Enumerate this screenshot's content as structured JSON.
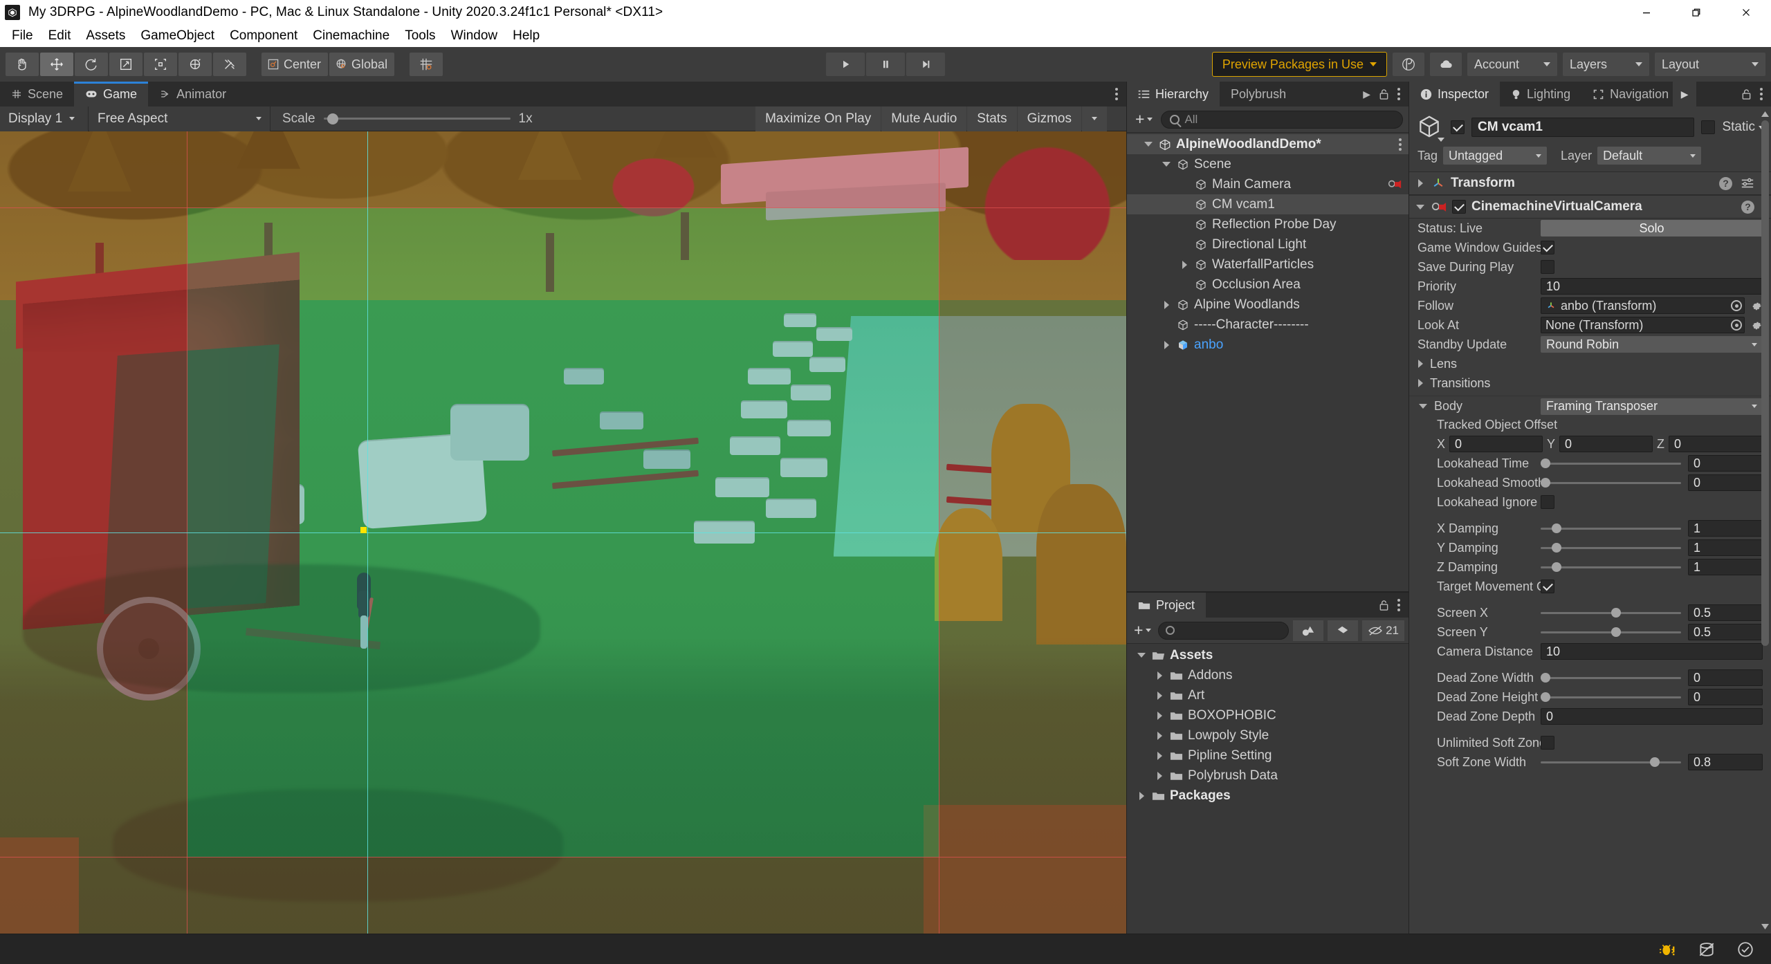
{
  "window": {
    "title": "My 3DRPG - AlpineWoodlandDemo - PC, Mac & Linux Standalone - Unity 2020.3.24f1c1 Personal* <DX11>",
    "app_icon": "unity-icon",
    "minimize": "minimize-icon",
    "maximize": "maximize-icon",
    "close": "close-icon"
  },
  "menubar": {
    "items": [
      "File",
      "Edit",
      "Assets",
      "GameObject",
      "Component",
      "Cinemachine",
      "Tools",
      "Window",
      "Help"
    ]
  },
  "toolbar": {
    "tools": [
      {
        "name": "hand-tool",
        "selected": false
      },
      {
        "name": "move-tool",
        "selected": true
      },
      {
        "name": "rotate-tool",
        "selected": false
      },
      {
        "name": "scale-tool",
        "selected": false
      },
      {
        "name": "rect-tool",
        "selected": false
      },
      {
        "name": "transform-tool",
        "selected": false
      },
      {
        "name": "custom-editor-tool",
        "selected": false
      }
    ],
    "pivot_label": "Center",
    "handle_label": "Global",
    "snap_label": "grid-snap-icon",
    "play": "play-icon",
    "pause": "pause-icon",
    "step": "step-icon",
    "preview_packages": "Preview Packages in Use",
    "collab_icon": "collab-icon",
    "cloud_icon": "cloud-icon",
    "account_label": "Account",
    "layers_label": "Layers",
    "layout_label": "Layout"
  },
  "game_panel": {
    "tabs": [
      {
        "label": "Scene",
        "icon": "grid-icon",
        "active": false
      },
      {
        "label": "Game",
        "icon": "gamepad-icon",
        "active": true
      },
      {
        "label": "Animator",
        "icon": "animator-icon",
        "active": false
      }
    ],
    "display": "Display 1",
    "aspect": "Free Aspect",
    "scale_label": "Scale",
    "scale_value": "1x",
    "scale_percent": 2,
    "maximize_on_play": "Maximize On Play",
    "mute_audio": "Mute Audio",
    "stats": "Stats",
    "gizmos": "Gizmos"
  },
  "hierarchy": {
    "tabs": [
      {
        "label": "Hierarchy",
        "icon": "hierarchy-icon",
        "active": true
      },
      {
        "label": "Polybrush",
        "icon": "polybrush-icon",
        "active": false
      }
    ],
    "search_placeholder": "All",
    "create_label": "+",
    "items": [
      {
        "label": "AlpineWoodlandDemo*",
        "depth": 0,
        "twist": "open",
        "icon": "unity-scene-icon",
        "selected": false,
        "root": true,
        "blue": false,
        "badge": ""
      },
      {
        "label": "Scene",
        "depth": 1,
        "twist": "open",
        "icon": "gameobject-icon",
        "selected": false,
        "root": false,
        "blue": false,
        "badge": ""
      },
      {
        "label": "Main Camera",
        "depth": 2,
        "twist": "none",
        "icon": "gameobject-icon",
        "selected": false,
        "root": false,
        "blue": false,
        "badge": "cinemachine-brain-icon"
      },
      {
        "label": "CM vcam1",
        "depth": 2,
        "twist": "none",
        "icon": "gameobject-icon",
        "selected": true,
        "root": false,
        "blue": false,
        "badge": ""
      },
      {
        "label": "Reflection Probe Day",
        "depth": 2,
        "twist": "none",
        "icon": "gameobject-icon",
        "selected": false,
        "root": false,
        "blue": false,
        "badge": ""
      },
      {
        "label": "Directional Light",
        "depth": 2,
        "twist": "none",
        "icon": "gameobject-icon",
        "selected": false,
        "root": false,
        "blue": false,
        "badge": ""
      },
      {
        "label": "WaterfallParticles",
        "depth": 2,
        "twist": "closed",
        "icon": "gameobject-icon",
        "selected": false,
        "root": false,
        "blue": false,
        "badge": ""
      },
      {
        "label": "Occlusion Area",
        "depth": 2,
        "twist": "none",
        "icon": "gameobject-icon",
        "selected": false,
        "root": false,
        "blue": false,
        "badge": ""
      },
      {
        "label": "Alpine Woodlands",
        "depth": 1,
        "twist": "closed",
        "icon": "gameobject-icon",
        "selected": false,
        "root": false,
        "blue": false,
        "badge": ""
      },
      {
        "label": "-----Character--------",
        "depth": 1,
        "twist": "none",
        "icon": "gameobject-icon",
        "selected": false,
        "root": false,
        "blue": false,
        "badge": ""
      },
      {
        "label": "anbo",
        "depth": 1,
        "twist": "closed",
        "icon": "prefab-icon",
        "selected": false,
        "root": false,
        "blue": true,
        "badge": ""
      }
    ]
  },
  "project": {
    "tab_label": "Project",
    "search_placeholder": "",
    "hidden_count": "21",
    "items": [
      {
        "label": "Assets",
        "depth": 0,
        "twist": "open",
        "bold": true
      },
      {
        "label": "Addons",
        "depth": 1,
        "twist": "closed",
        "bold": false
      },
      {
        "label": "Art",
        "depth": 1,
        "twist": "closed",
        "bold": false
      },
      {
        "label": "BOXOPHOBIC",
        "depth": 1,
        "twist": "closed",
        "bold": false
      },
      {
        "label": "Lowpoly Style",
        "depth": 1,
        "twist": "closed",
        "bold": false
      },
      {
        "label": "Pipline Setting",
        "depth": 1,
        "twist": "closed",
        "bold": false
      },
      {
        "label": "Polybrush Data",
        "depth": 1,
        "twist": "closed",
        "bold": false
      },
      {
        "label": "Packages",
        "depth": 0,
        "twist": "closed",
        "bold": true
      }
    ]
  },
  "inspector": {
    "tabs": [
      {
        "label": "Inspector",
        "icon": "info-icon",
        "active": true
      },
      {
        "label": "Lighting",
        "icon": "lightbulb-icon",
        "active": false
      },
      {
        "label": "Navigation",
        "icon": "navigation-icon",
        "active": false
      }
    ],
    "object_name": "CM vcam1",
    "enabled": true,
    "static_label": "Static",
    "tag_label": "Tag",
    "tag_value": "Untagged",
    "layer_label": "Layer",
    "layer_value": "Default",
    "transform_component": "Transform",
    "vcam_component": "CinemachineVirtualCamera",
    "vcam_enabled": true,
    "status_label": "Status: Live",
    "solo_label": "Solo",
    "properties": [
      {
        "label": "Game Window Guides",
        "type": "checkbox",
        "value": true
      },
      {
        "label": "Save During Play",
        "type": "checkbox",
        "value": false
      },
      {
        "label": "Priority",
        "type": "field",
        "value": "10"
      },
      {
        "label": "Follow",
        "type": "object",
        "value": "anbo (Transform)",
        "has_icon": true
      },
      {
        "label": "Look At",
        "type": "object",
        "value": "None (Transform)",
        "has_icon": false
      },
      {
        "label": "Standby Update",
        "type": "dropdown",
        "value": "Round Robin"
      }
    ],
    "lens_label": "Lens",
    "transitions_label": "Transitions",
    "body_label": "Body",
    "body_value": "Framing Transposer",
    "tracked_object_offset_label": "Tracked Object Offset",
    "offset": {
      "x_label": "X",
      "x": "0",
      "y_label": "Y",
      "y": "0",
      "z_label": "Z",
      "z": "0"
    },
    "body_properties": [
      {
        "label": "Lookahead Time",
        "type": "slider",
        "value": "0",
        "percent": 0
      },
      {
        "label": "Lookahead Smoothing",
        "type": "slider",
        "value": "0",
        "percent": 0
      },
      {
        "label": "Lookahead Ignore Y",
        "type": "checkbox",
        "value": false
      },
      {
        "label": "X Damping",
        "type": "slider",
        "value": "1",
        "percent": 8
      },
      {
        "label": "Y Damping",
        "type": "slider",
        "value": "1",
        "percent": 8
      },
      {
        "label": "Z Damping",
        "type": "slider",
        "value": "1",
        "percent": 8
      },
      {
        "label": "Target Movement Only",
        "type": "checkbox",
        "value": true
      },
      {
        "label": "Screen X",
        "type": "slider",
        "value": "0.5",
        "percent": 50
      },
      {
        "label": "Screen Y",
        "type": "slider",
        "value": "0.5",
        "percent": 50
      },
      {
        "label": "Camera Distance",
        "type": "field",
        "value": "10"
      },
      {
        "label": "Dead Zone Width",
        "type": "slider",
        "value": "0",
        "percent": 0
      },
      {
        "label": "Dead Zone Height",
        "type": "slider",
        "value": "0",
        "percent": 0
      },
      {
        "label": "Dead Zone Depth",
        "type": "field",
        "value": "0"
      },
      {
        "label": "Unlimited Soft Zone",
        "type": "checkbox",
        "value": false
      },
      {
        "label": "Soft Zone Width",
        "type": "slider",
        "value": "0.8",
        "percent": 78
      }
    ]
  },
  "statusbar": {
    "message": "",
    "icons": [
      "bug-icon",
      "database-off-icon",
      "check-circle-icon"
    ]
  },
  "colors": {
    "accent_blue": "#2c82d8",
    "preview_yellow": "#e0a400",
    "link_blue": "#4aa3ff",
    "guide_red": "#c82828",
    "guide_green": "#28c882",
    "guide_cyan": "#5fe3e0",
    "target_yellow": "#ffe400"
  }
}
